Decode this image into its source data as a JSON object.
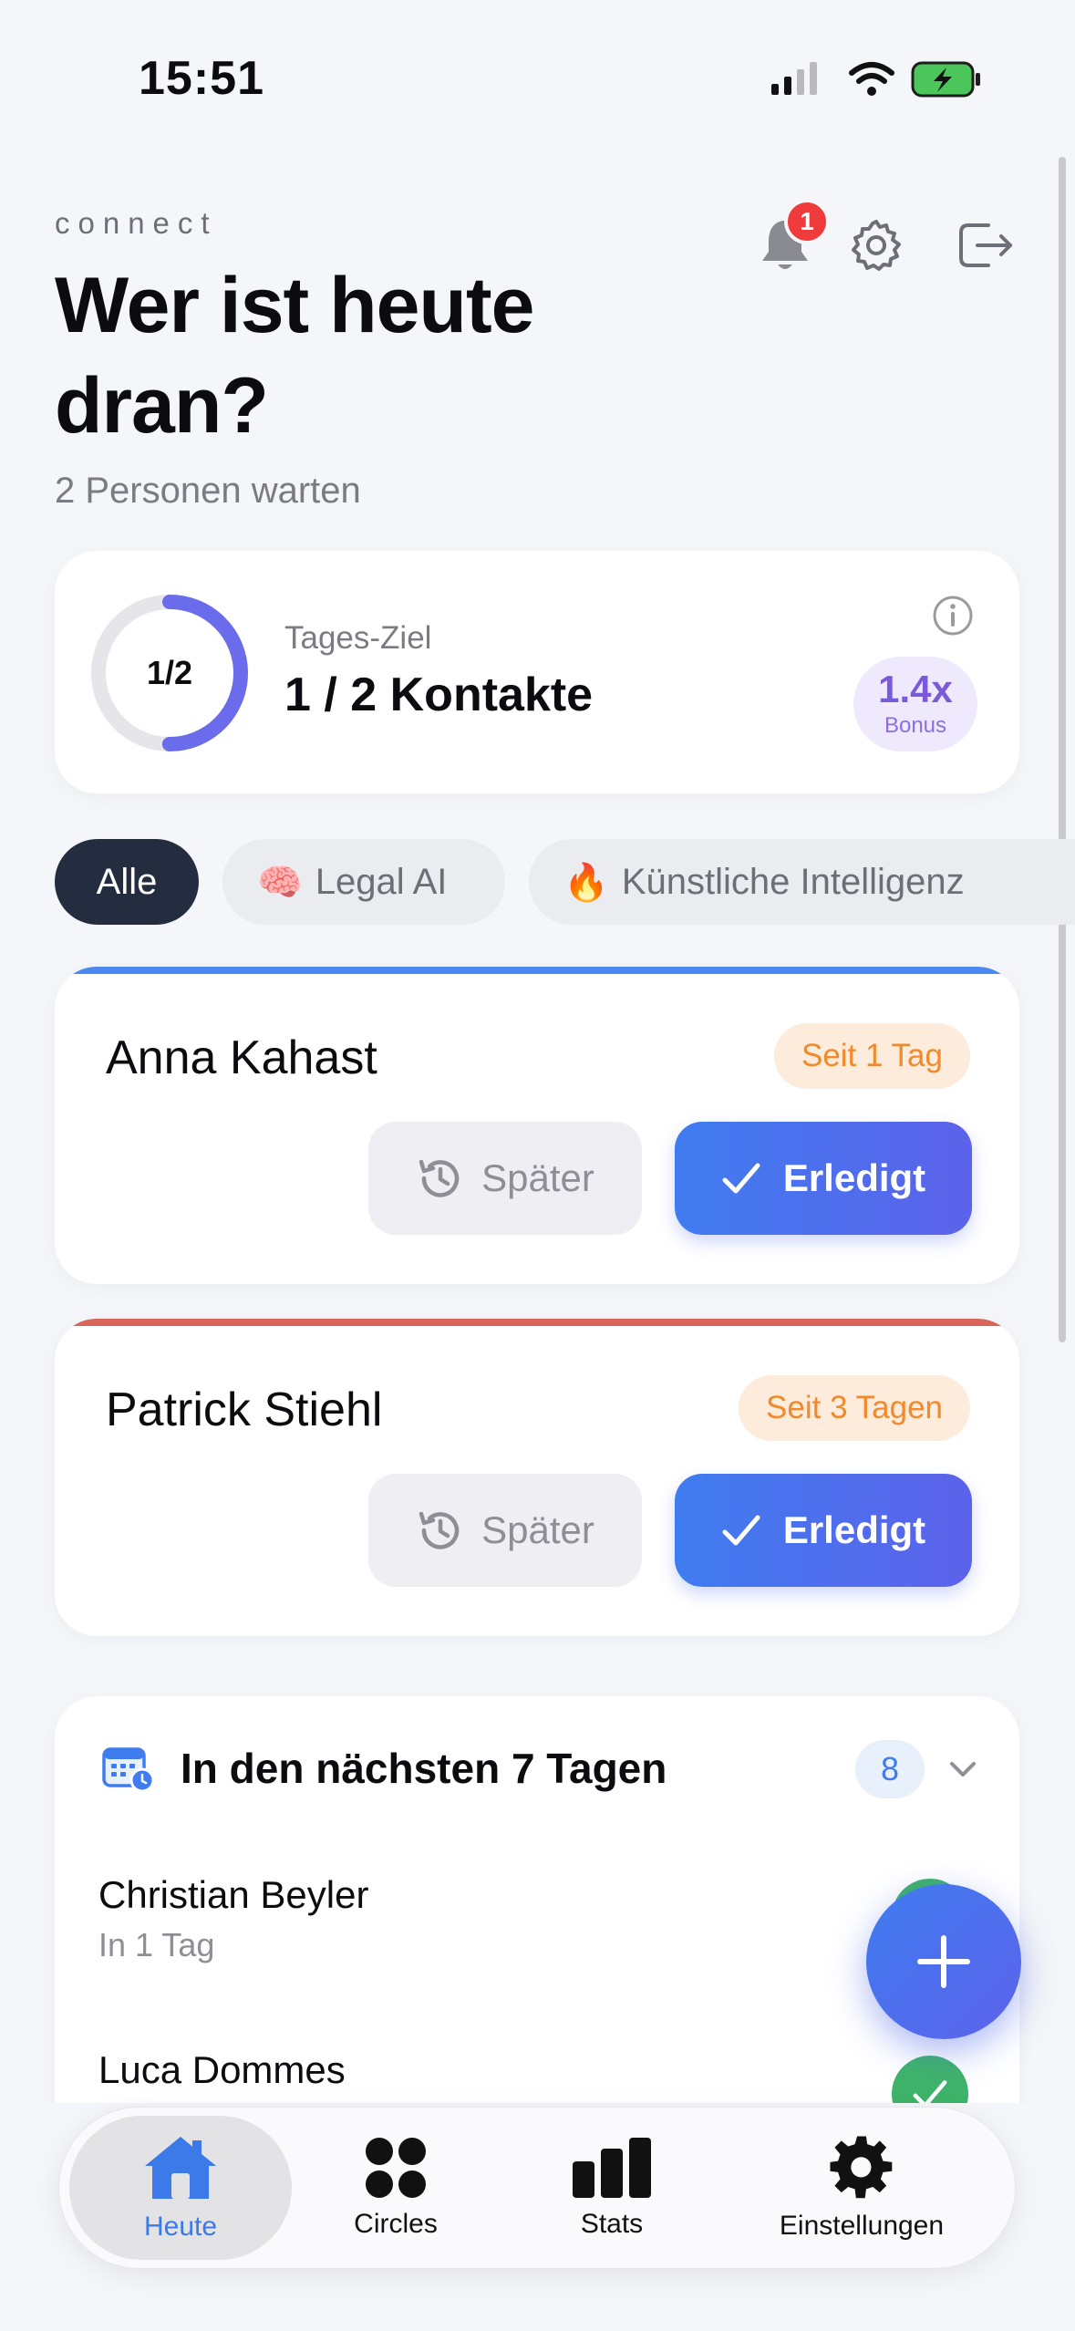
{
  "status_bar": {
    "time": "15:51"
  },
  "header": {
    "brand": "connect",
    "title": "Wer ist heute dran?",
    "subtitle": "2 Personen warten",
    "notification_count": "1"
  },
  "goal": {
    "ring_text": "1/2",
    "label": "Tages-Ziel",
    "value": "1 / 2 Kontakte",
    "progress": 0.5,
    "bonus_value": "1.4x",
    "bonus_label": "Bonus"
  },
  "filters": [
    {
      "label": "Alle",
      "emoji": ""
    },
    {
      "label": "Legal AI",
      "emoji": "🧠"
    },
    {
      "label": "Künstliche Intelligenz",
      "emoji": "🔥"
    }
  ],
  "contacts": [
    {
      "name": "Anna Kahast",
      "since": "Seit 1 Tag",
      "accent": "#4a8af0",
      "later_label": "Später",
      "done_label": "Erledigt"
    },
    {
      "name": "Patrick Stiehl",
      "since": "Seit 3 Tagen",
      "accent": "#d9645a",
      "later_label": "Später",
      "done_label": "Erledigt"
    }
  ],
  "upcoming": {
    "title": "In den nächsten 7 Tagen",
    "count": "8",
    "items": [
      {
        "name": "Christian Beyler",
        "sub": "In 1 Tag"
      },
      {
        "name": "Luca Dommes",
        "sub": ""
      }
    ]
  },
  "tabs": [
    {
      "label": "Heute",
      "icon": "house-icon"
    },
    {
      "label": "Circles",
      "icon": "circles-icon"
    },
    {
      "label": "Stats",
      "icon": "bar-chart-icon"
    },
    {
      "label": "Einstellungen",
      "icon": "gear-icon"
    }
  ],
  "colors": {
    "accent_blue": "#3f7cf0",
    "accent_purple": "#5c62ea",
    "badge_red": "#ef3b3b",
    "success_green": "#3fb36a",
    "bonus_purple": "#7b5ad8",
    "since_orange": "#f08a2c"
  }
}
